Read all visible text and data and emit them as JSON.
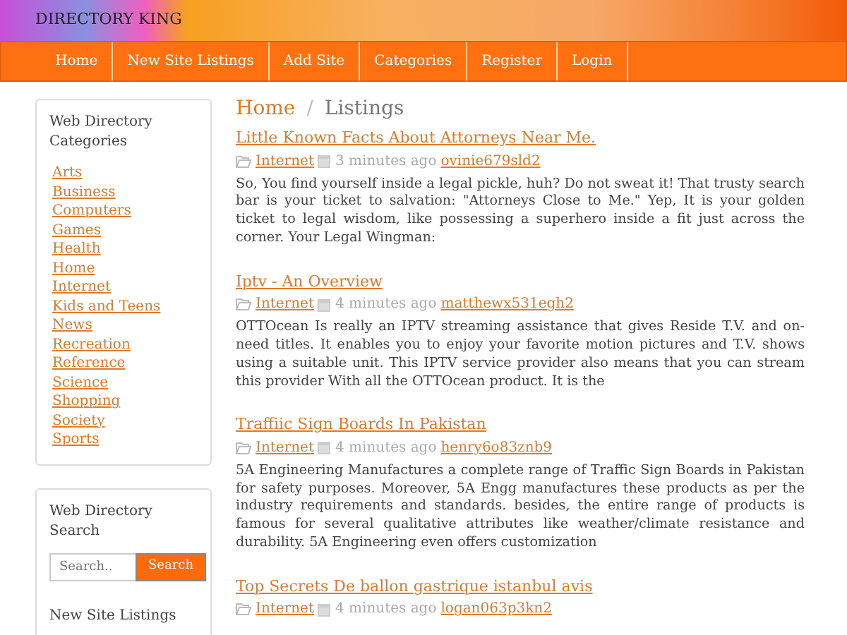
{
  "site_title": "DIRECTORY KING",
  "nav": [
    {
      "label": "Home"
    },
    {
      "label": "New Site Listings"
    },
    {
      "label": "Add Site"
    },
    {
      "label": "Categories"
    },
    {
      "label": "Register"
    },
    {
      "label": "Login"
    }
  ],
  "sidebar": {
    "categories_title": "Web Directory Categories",
    "categories": [
      "Arts",
      "Business",
      "Computers",
      "Games",
      "Health",
      "Home",
      "Internet",
      "Kids and Teens",
      "News",
      "Recreation",
      "Reference",
      "Science",
      "Shopping",
      "Society",
      "Sports"
    ],
    "search_title": "Web Directory Search",
    "search": {
      "placeholder": "Search..",
      "button": "Search"
    },
    "new_listings_title": "New Site Listings"
  },
  "breadcrumb_separator": "/",
  "breadcrumb": [
    {
      "label": "Home",
      "selected": false
    },
    {
      "label": "Listings",
      "selected": true
    }
  ],
  "listings": [
    {
      "title": "Little Known Facts About Attorneys Near Me.",
      "category": "Internet",
      "time": "3 minutes ago",
      "user": "ovinie679sld2",
      "text": "So, You find yourself inside a legal pickle, huh? Do not sweat it! That trusty search bar is your ticket to salvation: \"Attorneys Close to Me.\" Yep, It is your golden ticket to legal wisdom, like possessing a superhero inside a fit just across the corner. Your Legal Wingman:"
    },
    {
      "title": "Iptv - An Overview",
      "category": "Internet",
      "time": "4 minutes ago",
      "user": "matthewx531egh2",
      "text": "OTTOcean Is really an IPTV streaming assistance that gives Reside T.V. and on-need titles. It enables you to enjoy your favorite motion pictures and T.V. shows using a suitable unit. This IPTV service provider also means that you can stream this provider With all the OTTOcean product. It is the"
    },
    {
      "title": "Traffiic Sign Boards In Pakistan",
      "category": "Internet",
      "time": "4 minutes ago",
      "user": "henry6o83znb9",
      "text": "5A Engineering Manufactures a complete range of Traffic Sign Boards in Pakistan for safety purposes. Moreover, 5A Engg manufactures these products as per the industry requirements and standards. besides, the entire range of products is famous for several qualitative attributes like weather/climate resistance and durability. 5A Engineering even offers customization"
    },
    {
      "title": "Top Secrets De ballon gastrique istanbul avis",
      "category": "Internet",
      "time": "4 minutes ago",
      "user": "logan063p3kn2"
    }
  ]
}
